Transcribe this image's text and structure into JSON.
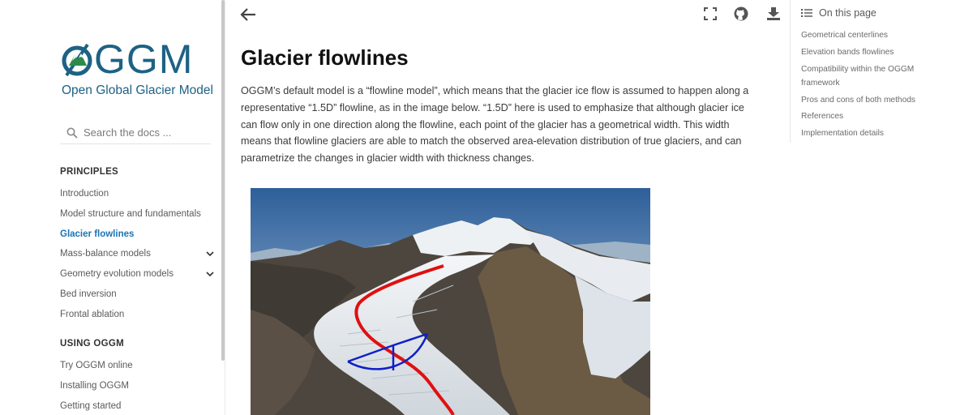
{
  "logo": {
    "wordmark": "GGM",
    "subtitle": "Open Global Glacier Model"
  },
  "search": {
    "placeholder": "Search the docs ..."
  },
  "sidebar": {
    "sections": [
      {
        "caption": "PRINCIPLES",
        "items": [
          {
            "label": "Introduction",
            "expandable": false,
            "active": false
          },
          {
            "label": "Model structure and fundamentals",
            "expandable": false,
            "active": false
          },
          {
            "label": "Glacier flowlines",
            "expandable": false,
            "active": true
          },
          {
            "label": "Mass-balance models",
            "expandable": true,
            "active": false
          },
          {
            "label": "Geometry evolution models",
            "expandable": true,
            "active": false
          },
          {
            "label": "Bed inversion",
            "expandable": false,
            "active": false
          },
          {
            "label": "Frontal ablation",
            "expandable": false,
            "active": false
          }
        ]
      },
      {
        "caption": "USING OGGM",
        "items": [
          {
            "label": "Try OGGM online",
            "expandable": false,
            "active": false
          },
          {
            "label": "Installing OGGM",
            "expandable": false,
            "active": false
          },
          {
            "label": "Getting started",
            "expandable": false,
            "active": false
          }
        ]
      }
    ]
  },
  "header": {
    "icons": [
      "back-arrow-icon",
      "fullscreen-icon",
      "github-icon",
      "download-icon"
    ]
  },
  "main": {
    "title": "Glacier flowlines",
    "paragraph": "OGGM’s default model is a “flowline model”, which means that the glacier ice flow is assumed to happen along a representative “1.5D” flowline, as in the image below. “1.5D” here is used to emphasize that although glacier ice can flow only in one direction along the flowline, each point of the glacier has a geometrical width. This width means that flowline glaciers are able to match the observed area-elevation distribution of true glaciers, and can parametrize the changes in glacier width with thickness changes."
  },
  "toc": {
    "header": "On this page",
    "items": [
      "Geometrical centerlines",
      "Elevation bands flowlines",
      "Compatibility within the OGGM framework",
      "Pros and cons of both methods",
      "References",
      "Implementation details"
    ]
  },
  "colors": {
    "brand": "#1d6284",
    "link_active": "#1a73b5",
    "flowline": "#e01010",
    "width_section": "#1020c8"
  }
}
